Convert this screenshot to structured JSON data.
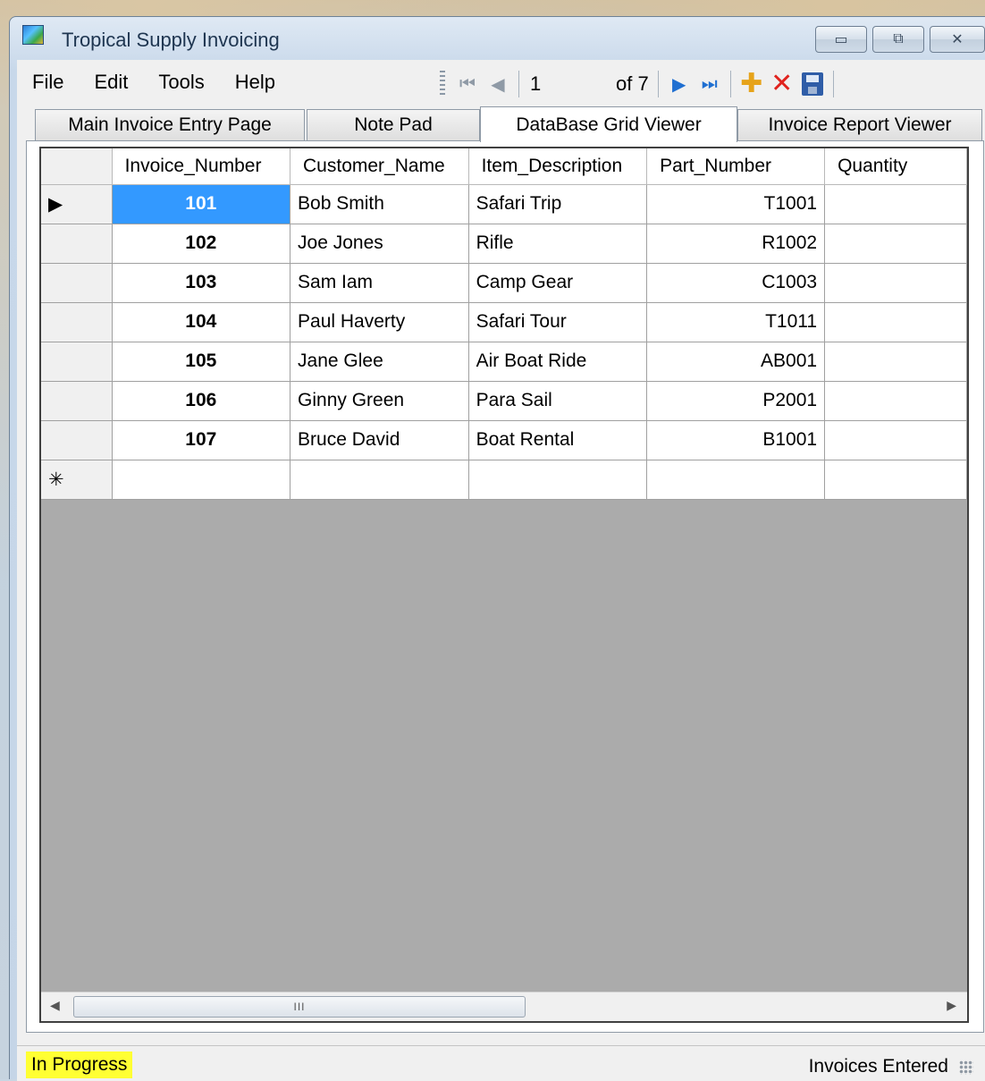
{
  "window": {
    "title": "Tropical Supply Invoicing",
    "controls": {
      "minimize": "▭",
      "maximize": "⧉",
      "close": "✕"
    }
  },
  "menu": {
    "items": [
      "File",
      "Edit",
      "Tools",
      "Help"
    ]
  },
  "navigator": {
    "position": "1",
    "count": "of 7",
    "icons": [
      "move-first-icon",
      "move-previous-icon",
      "move-next-icon",
      "move-last-icon",
      "add-new-icon",
      "delete-icon",
      "save-icon"
    ]
  },
  "tabs": [
    {
      "label": "Main Invoice Entry Page"
    },
    {
      "label": "Note Pad"
    },
    {
      "label": "DataBase Grid Viewer",
      "selected": true
    },
    {
      "label": "Invoice Report Viewer"
    }
  ],
  "grid": {
    "columns": [
      "Invoice_Number",
      "Customer_Name",
      "Item_Description",
      "Part_Number",
      "Quantity"
    ],
    "rows": [
      [
        "101",
        "Bob Smith",
        "Safari Trip",
        "T1001",
        ""
      ],
      [
        "102",
        "Joe Jones",
        "Rifle",
        "R1002",
        ""
      ],
      [
        "103",
        "Sam Iam",
        "Camp Gear",
        "C1003",
        ""
      ],
      [
        "104",
        "Paul Haverty",
        "Safari Tour",
        "T1011",
        ""
      ],
      [
        "105",
        "Jane Glee",
        "Air Boat Ride",
        "AB001",
        ""
      ],
      [
        "106",
        "Ginny Green",
        "Para Sail",
        "P2001",
        ""
      ],
      [
        "107",
        "Bruce David",
        "Boat Rental",
        "B1001",
        ""
      ]
    ],
    "current_row_marker": "▶",
    "new_row_marker": "✳",
    "scroll_thumb_label": "III"
  },
  "status": {
    "left": "In Progress",
    "right": "Invoices Entered"
  },
  "colors": {
    "selection": "#3399ff",
    "status_highlight": "#ffff33",
    "nav_active": "#1f6fd1",
    "add": "#e6a31a",
    "delete": "#e0231e"
  }
}
